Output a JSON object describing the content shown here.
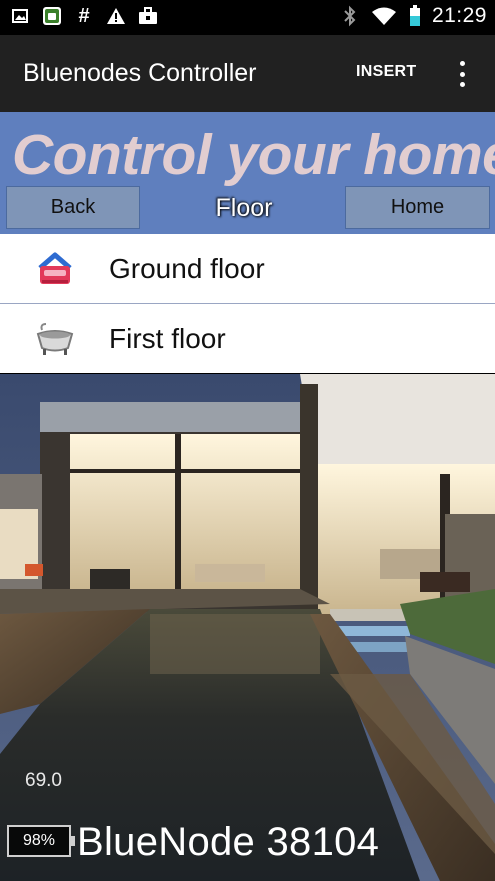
{
  "status_bar": {
    "left_icons": [
      "image-icon",
      "android-icon",
      "hash-icon",
      "warning-icon",
      "briefcase-icon"
    ],
    "right_icons": [
      "bluetooth-icon",
      "wifi-icon",
      "battery-icon"
    ],
    "time": "21:29"
  },
  "action_bar": {
    "title": "Bluenodes Controller",
    "insert_label": "INSERT"
  },
  "header": {
    "banner": "Control your home",
    "back_label": "Back",
    "section_label": "Floor",
    "home_label": "Home"
  },
  "floors": [
    {
      "label": "Ground floor",
      "icon": "house-icon"
    },
    {
      "label": "First floor",
      "icon": "bathtub-icon"
    }
  ],
  "footer": {
    "value": "69.0",
    "battery": "98%",
    "node_name": "BlueNode 38104"
  },
  "colors": {
    "header_blue": "#5f7fbe",
    "banner_text": "#e2cdd0",
    "action_bar": "#212121"
  }
}
